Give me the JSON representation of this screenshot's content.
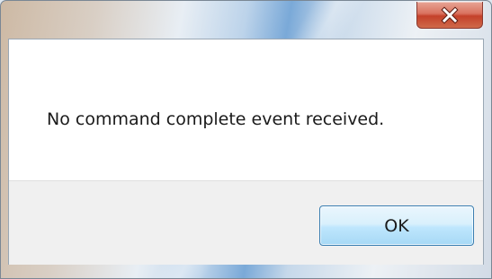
{
  "window": {
    "close_icon": "close-icon"
  },
  "message": {
    "text": "No command complete event received."
  },
  "buttons": {
    "ok_label": "OK"
  },
  "colors": {
    "close_button": "#c4412a",
    "ok_button_border": "#3c7fb1",
    "button_area_bg": "#f0f0f0"
  }
}
